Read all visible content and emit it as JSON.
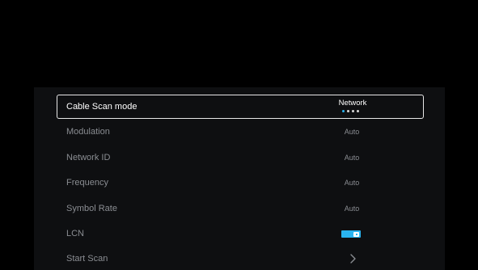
{
  "settings": {
    "items": [
      {
        "label": "Cable Scan mode",
        "value": "Network",
        "type": "selector",
        "options_count": 4,
        "selected_index": 0
      },
      {
        "label": "Modulation",
        "value": "Auto",
        "type": "value"
      },
      {
        "label": "Network ID",
        "value": "Auto",
        "type": "value"
      },
      {
        "label": "Frequency",
        "value": "Auto",
        "type": "value"
      },
      {
        "label": "Symbol Rate",
        "value": "Auto",
        "type": "value"
      },
      {
        "label": "LCN",
        "value": true,
        "type": "toggle"
      },
      {
        "label": "Start Scan",
        "type": "action",
        "icon": "chevron-right-icon"
      }
    ]
  },
  "colors": {
    "accent": "#2ab4f0",
    "panel_bg": "#0e0f11",
    "text_dim": "#8a8d92",
    "text_bright": "#ffffff"
  }
}
